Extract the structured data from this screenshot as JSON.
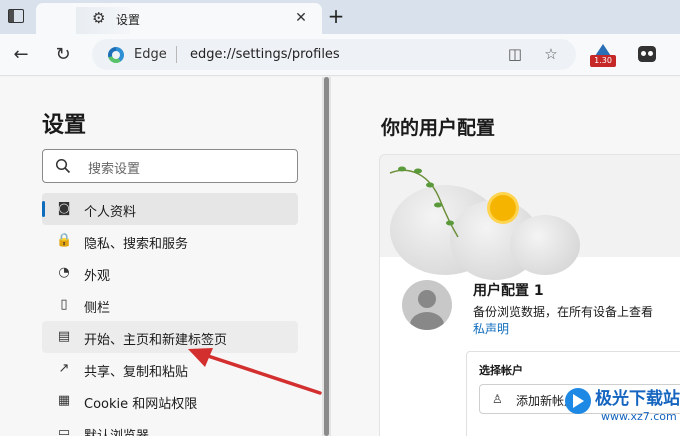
{
  "browser": {
    "tab_title": "设置",
    "close_glyph": "✕",
    "new_tab_glyph": "+",
    "address": {
      "site": "Edge",
      "url": "edge://settings/profiles"
    },
    "extension_badge": "1.30"
  },
  "sidebar": {
    "title": "设置",
    "search_placeholder": "搜索设置",
    "items": [
      {
        "label": "个人资料",
        "icon": "profile-icon",
        "glyph": "◙"
      },
      {
        "label": "隐私、搜索和服务",
        "icon": "lock-icon",
        "glyph": "🔒"
      },
      {
        "label": "外观",
        "icon": "palette-icon",
        "glyph": "◔"
      },
      {
        "label": "侧栏",
        "icon": "sidebar-icon",
        "glyph": "▯"
      },
      {
        "label": "开始、主页和新建标签页",
        "icon": "home-tab-icon",
        "glyph": "▤"
      },
      {
        "label": "共享、复制和粘贴",
        "icon": "share-icon",
        "glyph": "↗"
      },
      {
        "label": "Cookie 和网站权限",
        "icon": "cookie-icon",
        "glyph": "▦"
      },
      {
        "label": "默认浏览器",
        "icon": "browser-icon",
        "glyph": "▭"
      }
    ]
  },
  "main": {
    "title": "你的用户配置",
    "profile": {
      "name": "用户配置 1",
      "description": "备份浏览数据，在所有设备上查看",
      "privacy_link": "私声明"
    },
    "account": {
      "label": "选择帐户",
      "add_button": "添加新帐户"
    }
  },
  "watermark": {
    "text": "极光下载站",
    "url": "www.xz7.com"
  },
  "colors": {
    "accent": "#0f6cbd",
    "arrow": "#d32f2f"
  }
}
